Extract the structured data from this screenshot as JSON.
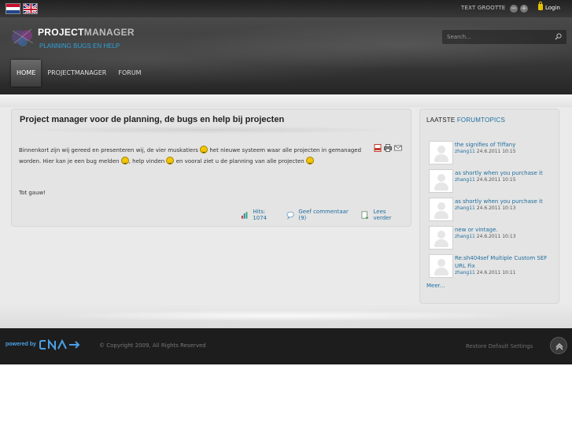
{
  "topbar": {
    "flags": [
      "Nederlands",
      "English"
    ],
    "text_size_label": "TEXT GROOTTE",
    "size_minus": "−",
    "size_plus": "+",
    "login_label": "Login"
  },
  "header": {
    "logo_main": "PROJECT",
    "logo_accent": "MANAGER",
    "subtitle": "PLANNING BUGS EN HELP",
    "search_placeholder": "Search..."
  },
  "nav": {
    "items": [
      {
        "label": "HOME",
        "active": true
      },
      {
        "label": "PROJECTMANAGER",
        "active": false
      },
      {
        "label": "FORUM",
        "active": false
      }
    ]
  },
  "article": {
    "title": "Project manager voor de planning, de bugs en help bij projecten",
    "icons": [
      "pdf-icon",
      "print-icon",
      "email-icon"
    ],
    "body_part1": "Binnenkort zijn wij gereed en presenteren wij, de vier muskatiers",
    "body_part2": "het nieuwe systeem waar alle projecten in gemanaged worden. Hier kan je een bug melden",
    "body_part3": ", help vinden",
    "body_part4": "en vooral ziet u de planning van alle projecten",
    "closing": "Tot gauw!",
    "hits": "Hits: 1074",
    "comment": "Geef commentaar (9)",
    "read_more": "Lees verder"
  },
  "sidebar": {
    "title_plain": "LAATSTE",
    "title_accent": "FORUMTOPICS",
    "items": [
      {
        "title": "the signifies of Tiffany",
        "user": "zhang11",
        "date": "24.6.2011 10:15"
      },
      {
        "title": "as shortly when you purchase it",
        "user": "zhang11",
        "date": "24.6.2011 10:15"
      },
      {
        "title": "as shortly when you purchase it",
        "user": "zhang11",
        "date": "24.6.2011 10:13"
      },
      {
        "title": "new or vintage.",
        "user": "zhang11",
        "date": "24.6.2011 10:13"
      },
      {
        "title": "Re:sh404sef Multiple Custom SEF URL Fix",
        "user": "zhang11",
        "date": "24.6.2011 10:11"
      }
    ],
    "more": "Meer..."
  },
  "footer": {
    "powered_by": "powered by",
    "copyright": "© Copyright 2009, All Rights Reserved",
    "restore": "Restore Default Settings"
  },
  "colors": {
    "accent_blue": "#1f6e9e",
    "subtitle_blue": "#2ea0d6",
    "header_dark": "#3a3a3a",
    "footer_dark": "#1d1d1d"
  }
}
